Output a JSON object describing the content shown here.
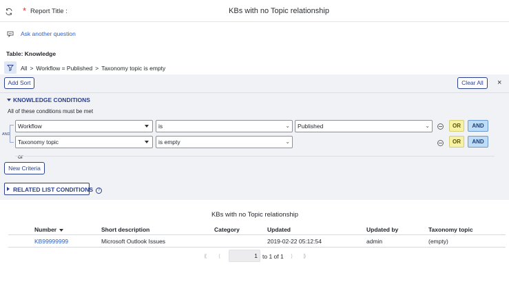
{
  "header": {
    "required_mark": "*",
    "report_title_label": "Report Title :",
    "title": "KBs with no Topic relationship"
  },
  "ask": {
    "label": "Ask another question"
  },
  "table_label": "Table: Knowledge",
  "breadcrumb": {
    "items": [
      "All",
      "Workflow = Published",
      "Taxonomy topic is empty"
    ],
    "separator": ">"
  },
  "toolbar": {
    "add_sort": "Add Sort",
    "clear_all": "Clear All",
    "close": "×"
  },
  "conditions": {
    "section_label": "KNOWLEDGE CONDITIONS",
    "match_label": "All of these conditions must be met",
    "and_label": "AND",
    "rows": [
      {
        "field": "Workflow",
        "operator": "is",
        "value": "Published"
      },
      {
        "field": "Taxonomy topic",
        "operator": "is empty"
      }
    ],
    "or_button": "OR",
    "and_button": "AND",
    "or_text": "or",
    "new_criteria": "New Criteria"
  },
  "related": {
    "label": "RELATED LIST CONDITIONS",
    "help": "?"
  },
  "results": {
    "title": "KBs with no Topic relationship",
    "columns": [
      "Number",
      "Short description",
      "Category",
      "Updated",
      "Updated by",
      "Taxonomy topic"
    ],
    "rows": [
      {
        "number": "KB99999999",
        "short_description": "Microsoft Outlook Issues",
        "category": "",
        "updated": "2019-02-22 05:12:54",
        "updated_by": "admin",
        "taxonomy_topic": "(empty)"
      }
    ]
  },
  "pager": {
    "current_page": "1",
    "of_text": "to 1 of 1"
  },
  "colors": {
    "accent": "#2b3f8c",
    "link": "#2a5ec9",
    "or_bg": "#f5f2a8",
    "and_bg": "#bfdcf6",
    "required": "#d6352b"
  }
}
